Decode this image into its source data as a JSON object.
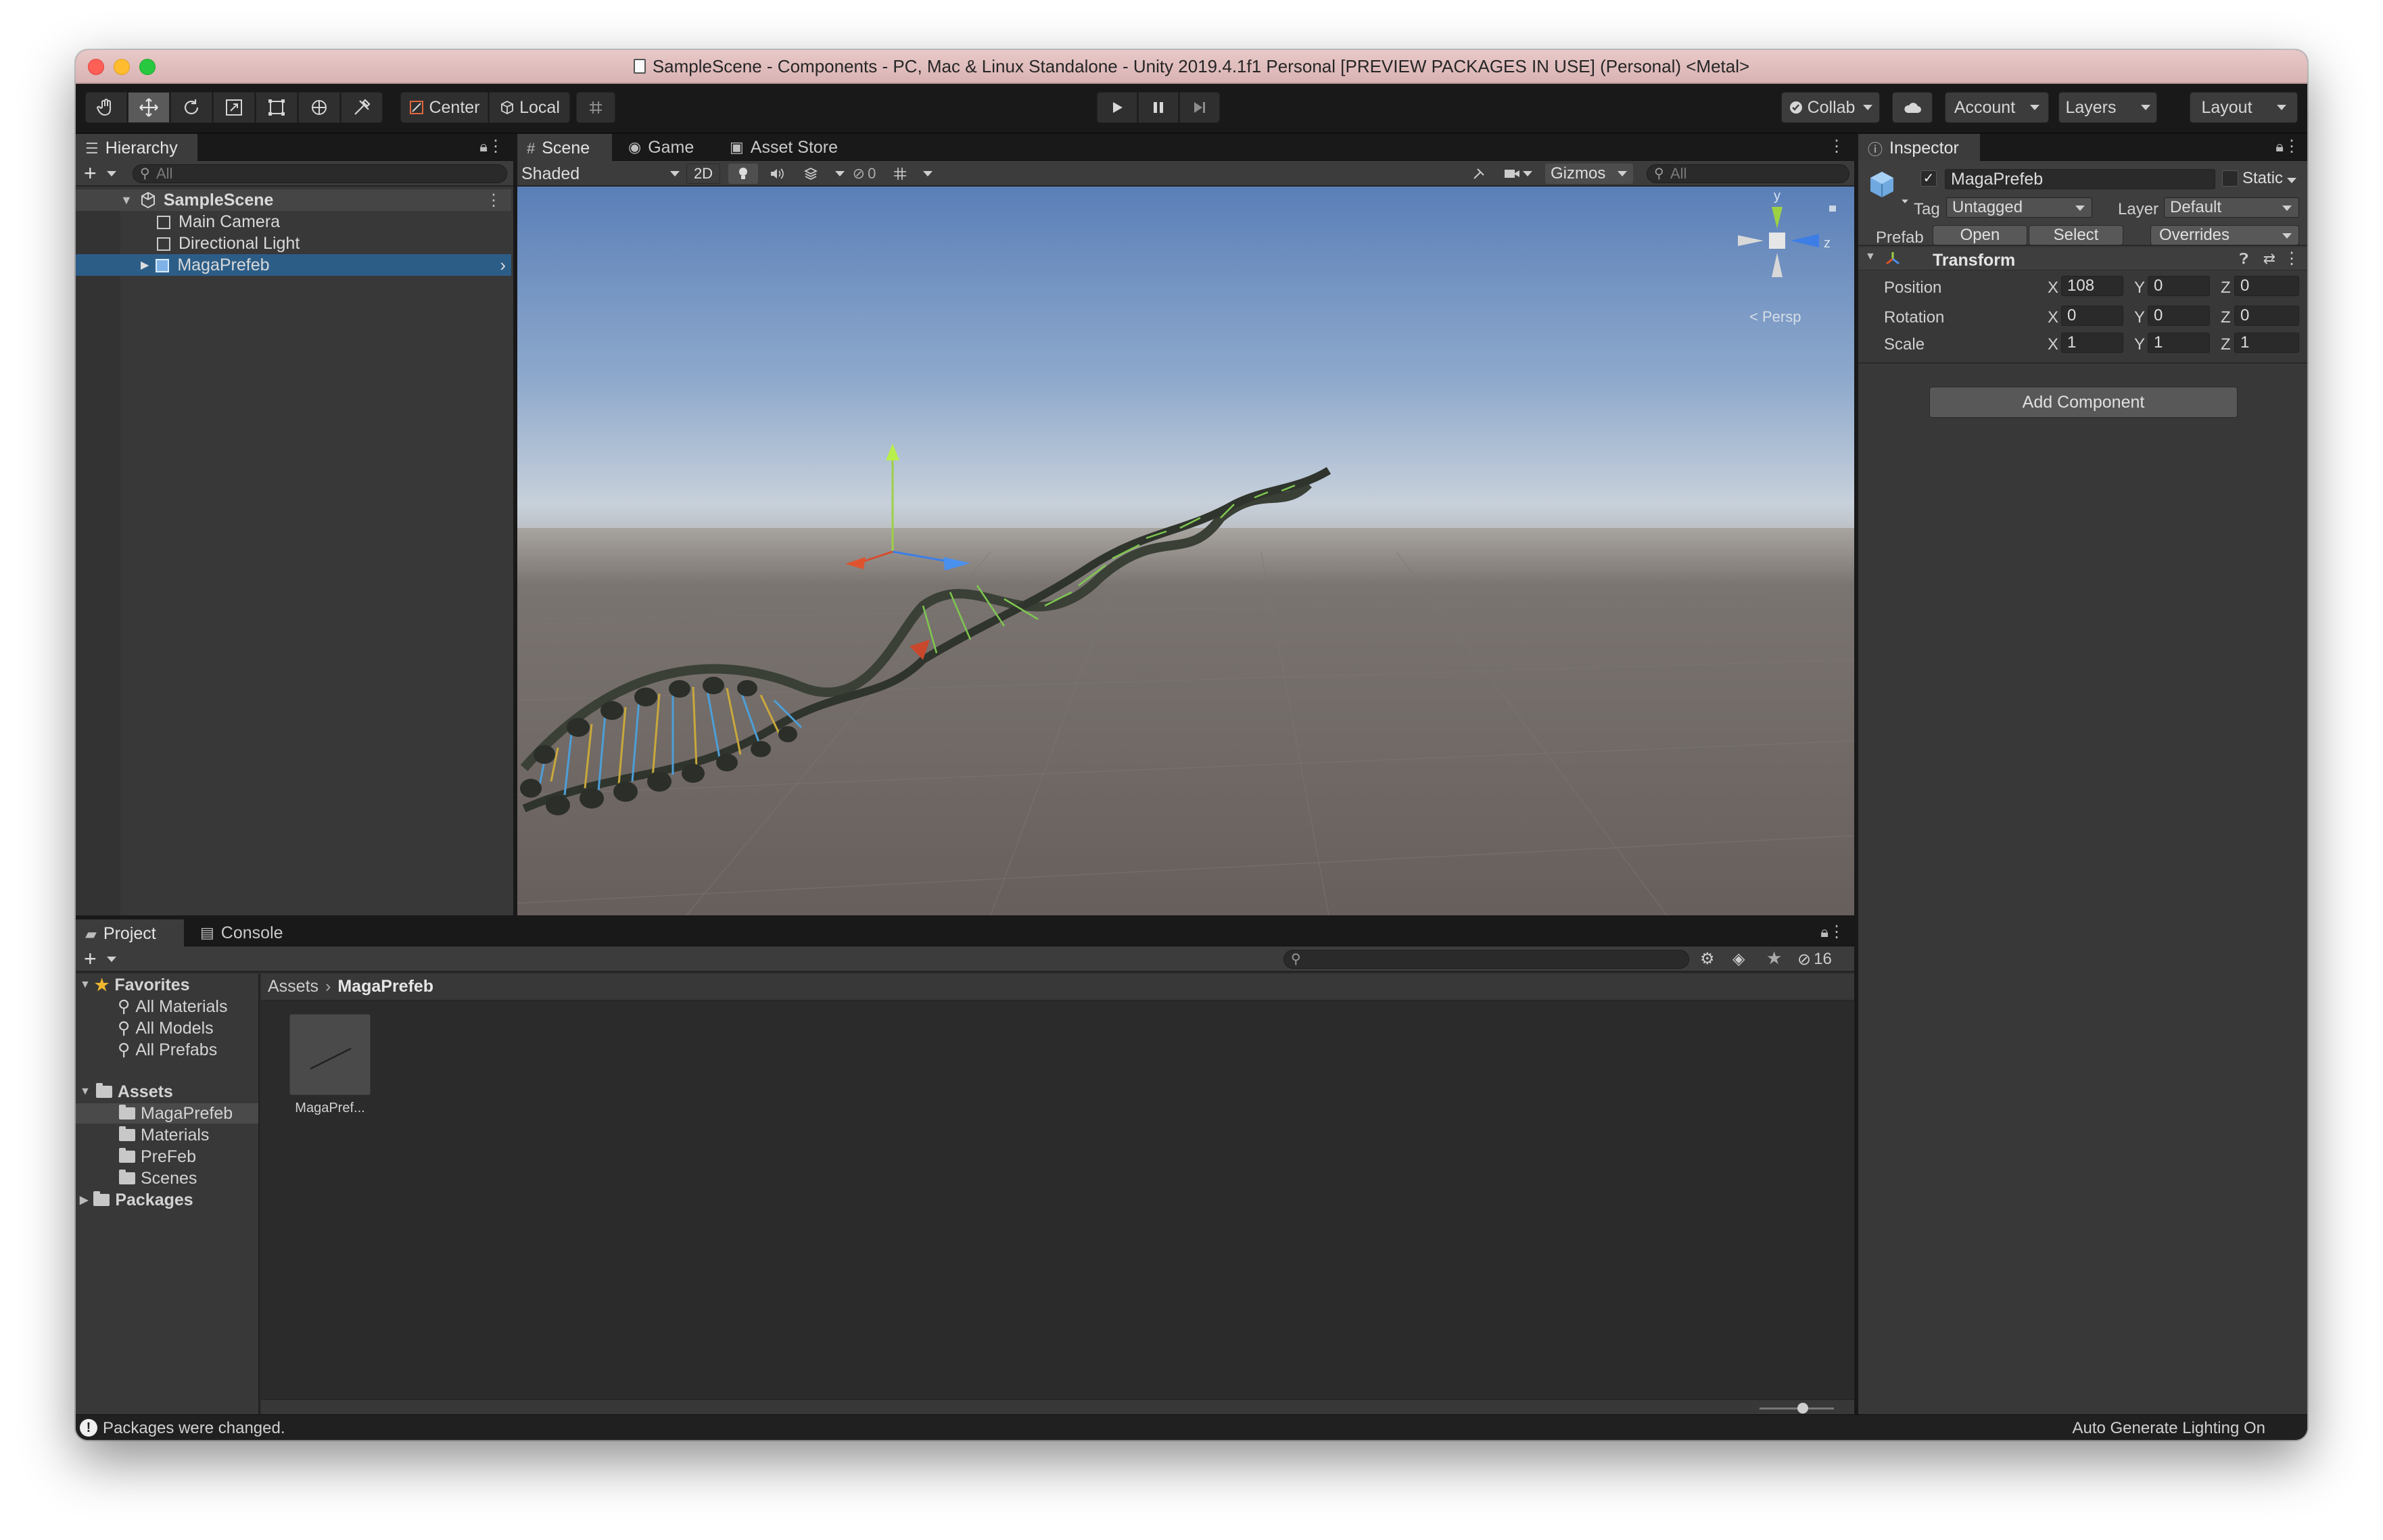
{
  "window": {
    "title": "SampleScene - Components - PC, Mac & Linux Standalone - Unity 2019.4.1f1 Personal [PREVIEW PACKAGES IN USE] (Personal) <Metal>"
  },
  "toolbar": {
    "tools": [
      "hand-tool",
      "move-tool",
      "rotate-tool",
      "scale-tool",
      "rect-tool",
      "transform-tool",
      "custom-tool"
    ],
    "pivot_label": "Center",
    "space_label": "Local",
    "collab_label": "Collab",
    "account_label": "Account",
    "layers_label": "Layers",
    "layout_label": "Layout"
  },
  "hierarchy": {
    "tab_label": "Hierarchy",
    "search_placeholder": "All",
    "scene_name": "SampleScene",
    "items": [
      {
        "label": "Main Camera"
      },
      {
        "label": "Directional Light"
      },
      {
        "label": "MagaPrefeb"
      }
    ]
  },
  "scene": {
    "tabs": [
      {
        "label": "Scene"
      },
      {
        "label": "Game"
      },
      {
        "label": "Asset Store"
      }
    ],
    "shading_mode": "Shaded",
    "mode_2d": "2D",
    "hidden_count": "0",
    "gizmos_label": "Gizmos",
    "search_placeholder": "All",
    "persp_label": "Persp",
    "gizmo_axes": {
      "y": "y",
      "z": "z"
    }
  },
  "inspector": {
    "tab_label": "Inspector",
    "object_name": "MagaPrefeb",
    "static_label": "Static",
    "tag_label": "Tag",
    "tag_value": "Untagged",
    "layer_label": "Layer",
    "layer_value": "Default",
    "prefab_label": "Prefab",
    "open_label": "Open",
    "select_label": "Select",
    "overrides_label": "Overrides",
    "transform_title": "Transform",
    "rows": [
      {
        "label": "Position",
        "x": "108",
        "y": "0",
        "z": "0"
      },
      {
        "label": "Rotation",
        "x": "0",
        "y": "0",
        "z": "0"
      },
      {
        "label": "Scale",
        "x": "1",
        "y": "1",
        "z": "1"
      }
    ],
    "axis_x": "X",
    "axis_y": "Y",
    "axis_z": "Z",
    "add_component_label": "Add Component"
  },
  "project": {
    "tabs": [
      {
        "label": "Project"
      },
      {
        "label": "Console"
      }
    ],
    "hidden_count": "16",
    "favorites_label": "Favorites",
    "favorites": [
      "All Materials",
      "All Models",
      "All Prefabs"
    ],
    "assets_label": "Assets",
    "asset_folders": [
      "MagaPrefeb",
      "Materials",
      "PreFeb",
      "Scenes"
    ],
    "packages_label": "Packages",
    "breadcrumb": [
      "Assets",
      "MagaPrefeb"
    ],
    "files": [
      {
        "label": "MagaPref..."
      }
    ]
  },
  "status": {
    "message": "Packages were changed.",
    "right": "Auto Generate Lighting On"
  },
  "colors": {
    "selection": "#2c5d87",
    "sky_top": "#5a7fb8",
    "ground": "#6d6763"
  }
}
